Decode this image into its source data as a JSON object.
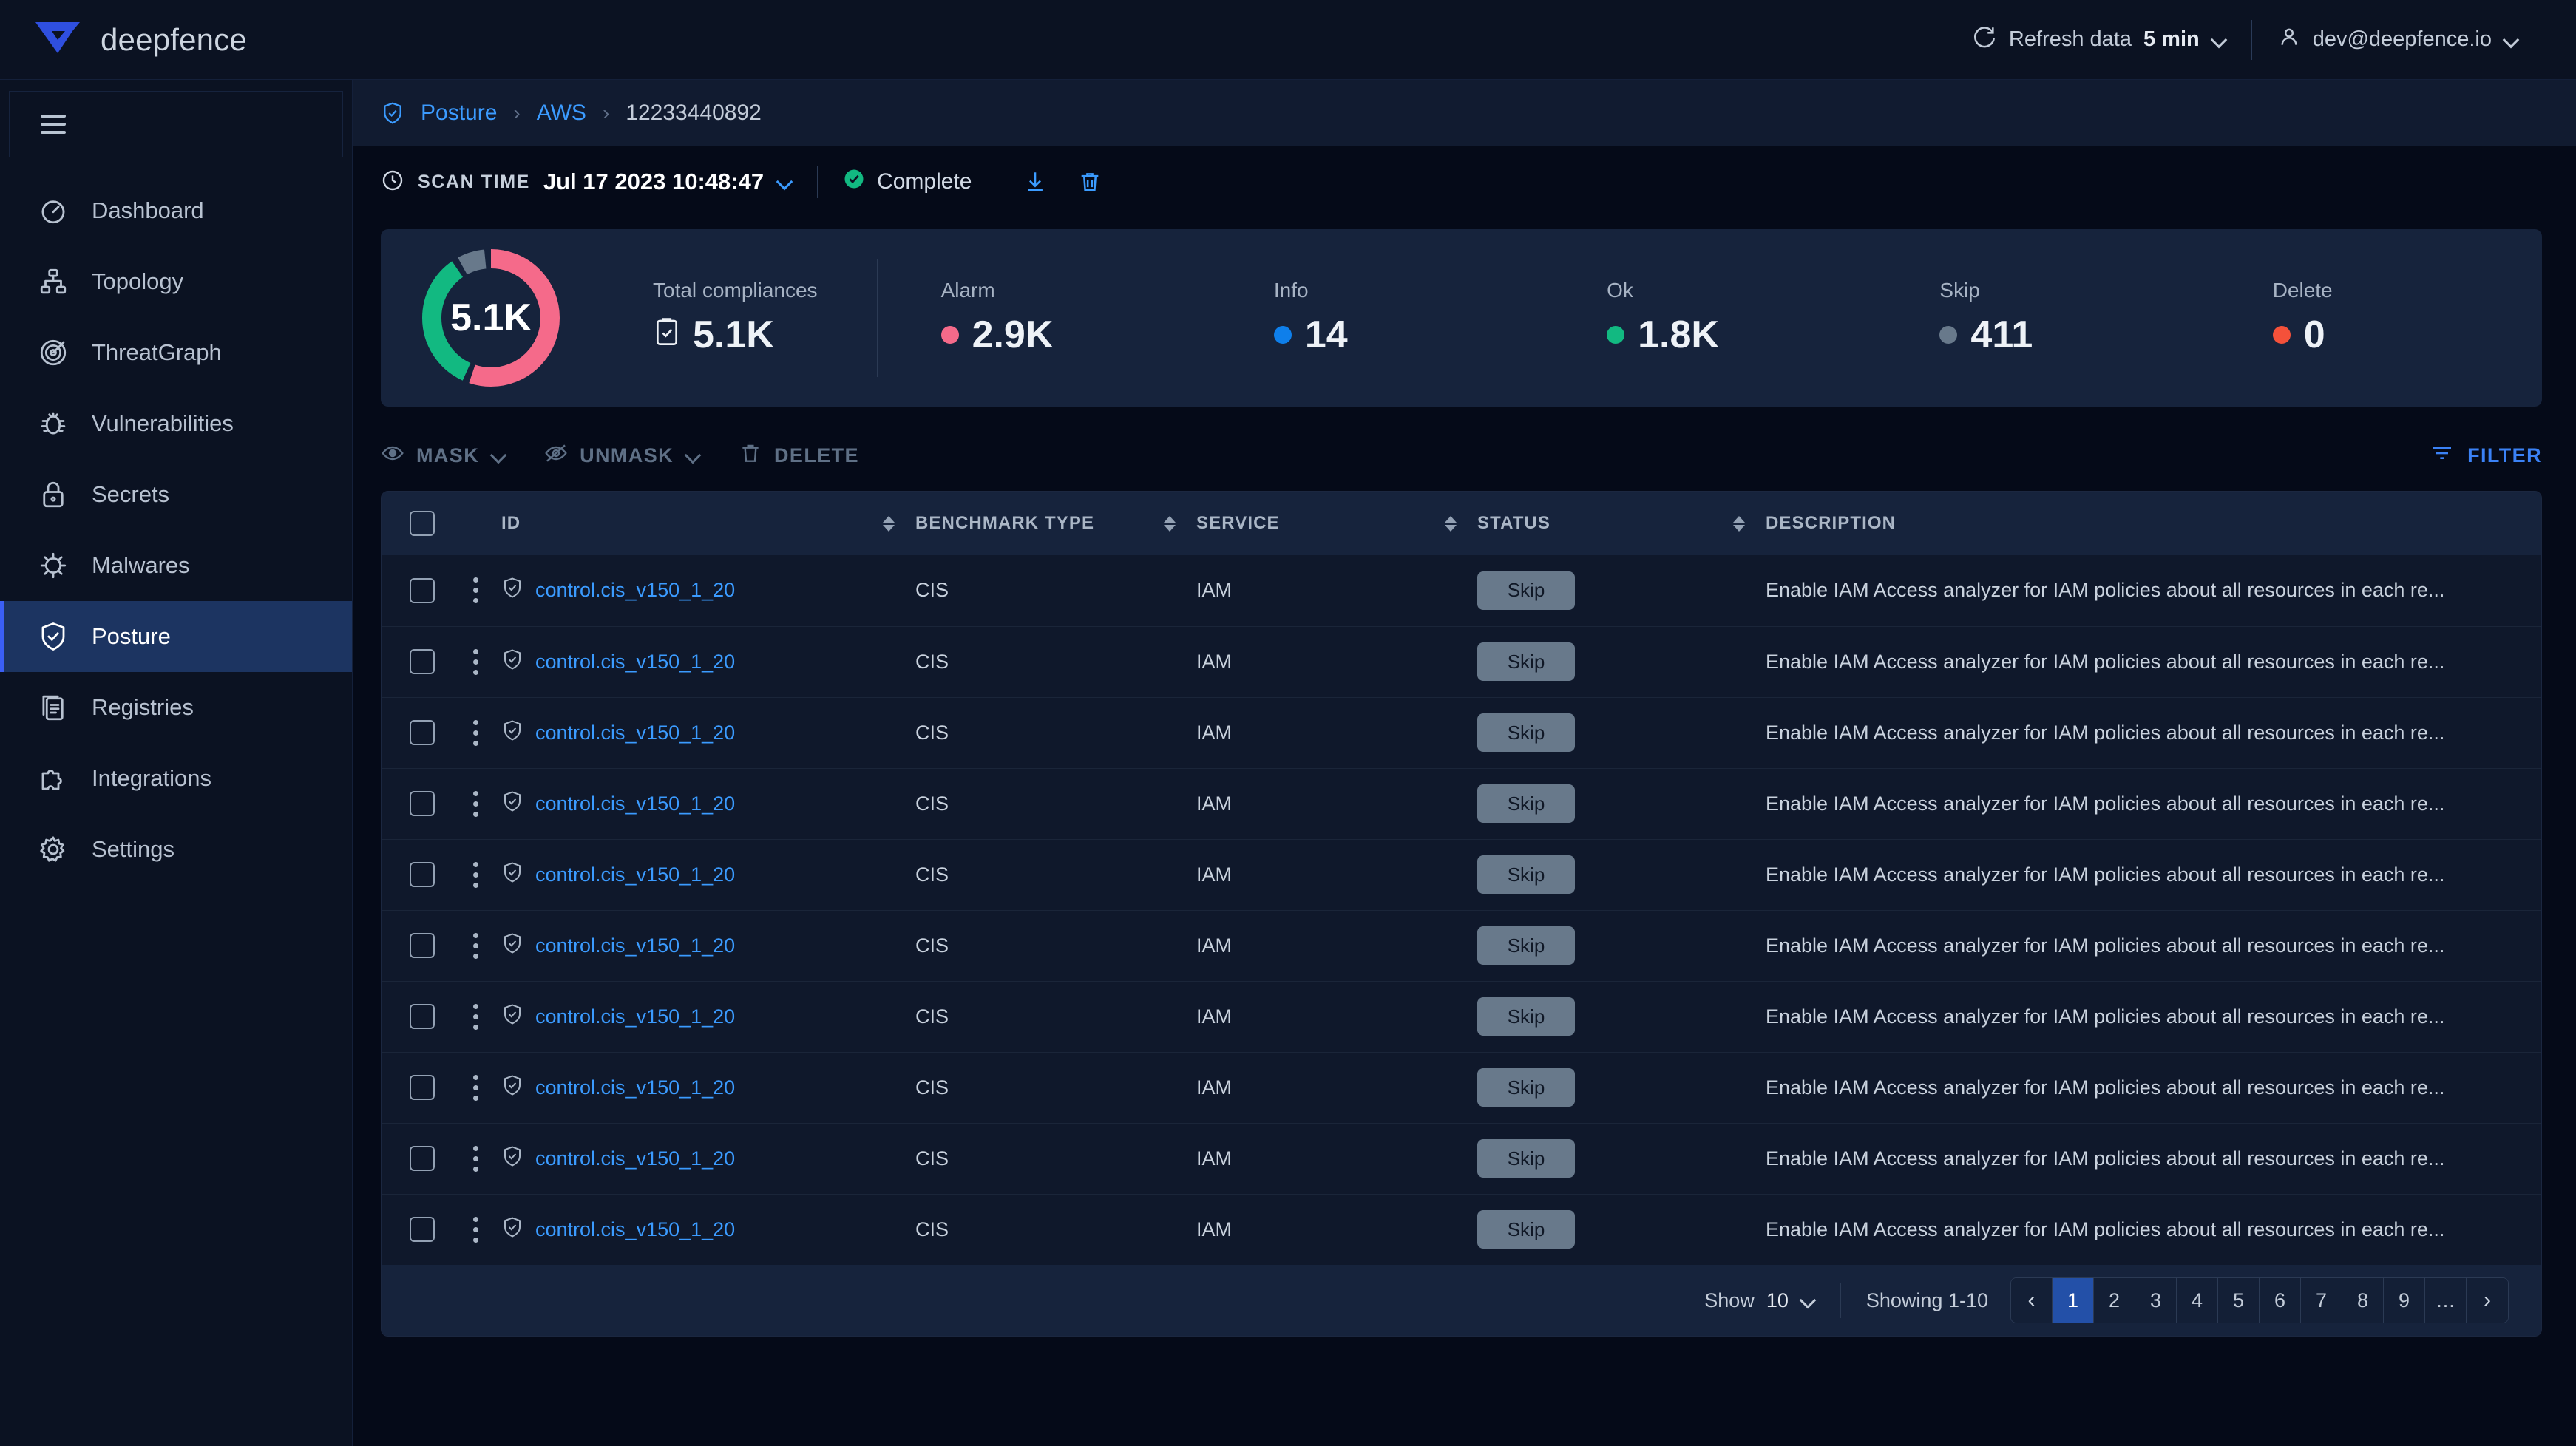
{
  "topbar": {
    "brand": "deepfence",
    "refresh_label": "Refresh data",
    "refresh_value": "5 min",
    "user": "dev@deepfence.io"
  },
  "sidebar": {
    "items": [
      {
        "label": "Dashboard",
        "icon": "gauge-icon",
        "active": false
      },
      {
        "label": "Topology",
        "icon": "topology-icon",
        "active": false
      },
      {
        "label": "ThreatGraph",
        "icon": "radar-icon",
        "active": false
      },
      {
        "label": "Vulnerabilities",
        "icon": "bug-icon",
        "active": false
      },
      {
        "label": "Secrets",
        "icon": "lock-icon",
        "active": false
      },
      {
        "label": "Malwares",
        "icon": "virus-icon",
        "active": false
      },
      {
        "label": "Posture",
        "icon": "shield-check-icon",
        "active": true
      },
      {
        "label": "Registries",
        "icon": "documents-icon",
        "active": false
      },
      {
        "label": "Integrations",
        "icon": "puzzle-icon",
        "active": false
      },
      {
        "label": "Settings",
        "icon": "gear-icon",
        "active": false
      }
    ]
  },
  "breadcrumb": {
    "root": "Posture",
    "provider": "AWS",
    "account": "12233440892",
    "separator": "›"
  },
  "scanbar": {
    "label": "SCAN TIME",
    "value": "Jul 17 2023 10:48:47",
    "status": "Complete",
    "download_icon": "download-icon",
    "delete_icon": "trash-icon"
  },
  "summary": {
    "donut_center": "5.1K",
    "total_label": "Total compliances",
    "total_value": "5.1K",
    "stats": [
      {
        "label": "Alarm",
        "value": "2.9K",
        "color": "#F56A8A"
      },
      {
        "label": "Info",
        "value": "14",
        "color": "#0E7FEB"
      },
      {
        "label": "Ok",
        "value": "1.8K",
        "color": "#12B981"
      },
      {
        "label": "Skip",
        "value": "411",
        "color": "#68798B"
      },
      {
        "label": "Delete",
        "value": "0",
        "color": "#F4513A"
      }
    ]
  },
  "chart_data": {
    "type": "pie",
    "title": "Total compliances",
    "categories": [
      "Alarm",
      "Ok",
      "Skip"
    ],
    "values": [
      2900,
      1800,
      411
    ],
    "colors": [
      "#F56A8A",
      "#12B981",
      "#68798B"
    ],
    "center_label": "5.1K",
    "total": 5111,
    "legend": "right",
    "donut": true
  },
  "toolbar": {
    "mask": "MASK",
    "unmask": "UNMASK",
    "delete": "DELETE",
    "filter": "FILTER"
  },
  "table": {
    "columns": [
      {
        "label": "ID",
        "sortable": true
      },
      {
        "label": "BENCHMARK TYPE",
        "sortable": true
      },
      {
        "label": "SERVICE",
        "sortable": true
      },
      {
        "label": "STATUS",
        "sortable": true
      },
      {
        "label": "DESCRIPTION",
        "sortable": false
      }
    ],
    "rows": [
      {
        "id": "control.cis_v150_1_20",
        "benchmark": "CIS",
        "service": "IAM",
        "status": "Skip",
        "description": "Enable IAM Access analyzer for IAM policies about all resources in each re..."
      },
      {
        "id": "control.cis_v150_1_20",
        "benchmark": "CIS",
        "service": "IAM",
        "status": "Skip",
        "description": "Enable IAM Access analyzer for IAM policies about all resources in each re..."
      },
      {
        "id": "control.cis_v150_1_20",
        "benchmark": "CIS",
        "service": "IAM",
        "status": "Skip",
        "description": "Enable IAM Access analyzer for IAM policies about all resources in each re..."
      },
      {
        "id": "control.cis_v150_1_20",
        "benchmark": "CIS",
        "service": "IAM",
        "status": "Skip",
        "description": "Enable IAM Access analyzer for IAM policies about all resources in each re..."
      },
      {
        "id": "control.cis_v150_1_20",
        "benchmark": "CIS",
        "service": "IAM",
        "status": "Skip",
        "description": "Enable IAM Access analyzer for IAM policies about all resources in each re..."
      },
      {
        "id": "control.cis_v150_1_20",
        "benchmark": "CIS",
        "service": "IAM",
        "status": "Skip",
        "description": "Enable IAM Access analyzer for IAM policies about all resources in each re..."
      },
      {
        "id": "control.cis_v150_1_20",
        "benchmark": "CIS",
        "service": "IAM",
        "status": "Skip",
        "description": "Enable IAM Access analyzer for IAM policies about all resources in each re..."
      },
      {
        "id": "control.cis_v150_1_20",
        "benchmark": "CIS",
        "service": "IAM",
        "status": "Skip",
        "description": "Enable IAM Access analyzer for IAM policies about all resources in each re..."
      },
      {
        "id": "control.cis_v150_1_20",
        "benchmark": "CIS",
        "service": "IAM",
        "status": "Skip",
        "description": "Enable IAM Access analyzer for IAM policies about all resources in each re..."
      },
      {
        "id": "control.cis_v150_1_20",
        "benchmark": "CIS",
        "service": "IAM",
        "status": "Skip",
        "description": "Enable IAM Access analyzer for IAM policies about all resources in each re..."
      }
    ]
  },
  "pagination": {
    "show_label": "Show",
    "show_value": "10",
    "showing": "Showing 1-10",
    "prev": "‹",
    "next": "›",
    "pages": [
      "1",
      "2",
      "3",
      "4",
      "5",
      "6",
      "7",
      "8",
      "9",
      "…"
    ],
    "active_page": "1"
  }
}
